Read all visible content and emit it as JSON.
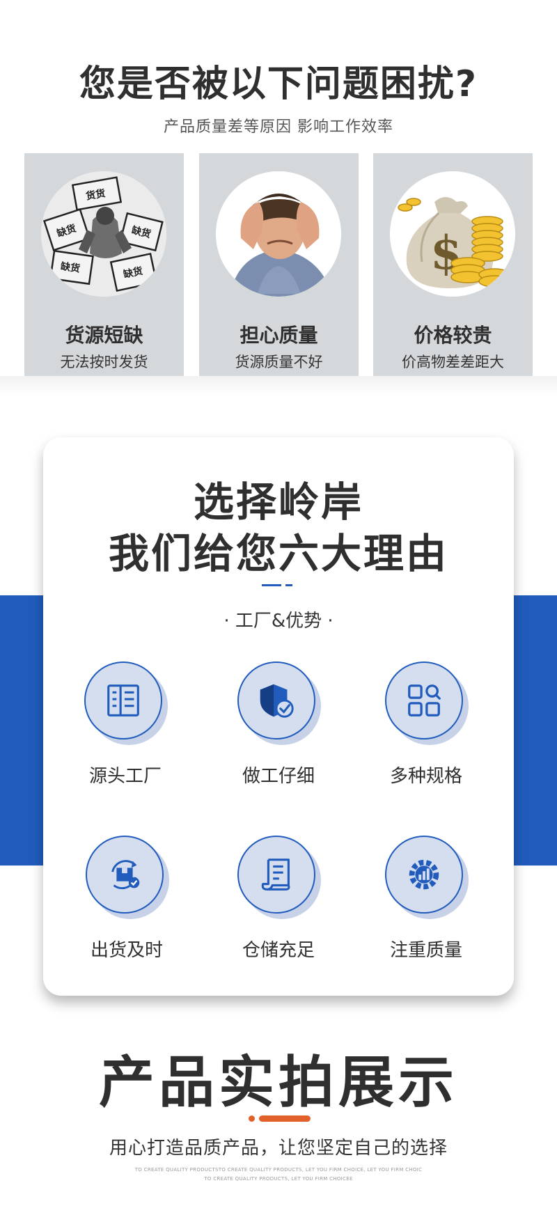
{
  "problems": {
    "title": "您是否被以下问题困扰?",
    "subtitle": "产品质量差等原因  影响工作效率",
    "cards": [
      {
        "title": "货源短缺",
        "desc": "无法按时发货",
        "image": "shipping-boxes-photo"
      },
      {
        "title": "担心质量",
        "desc": "货源质量不好",
        "image": "worried-man-photo"
      },
      {
        "title": "价格较贵",
        "desc": "价高物差差距大",
        "image": "money-bag-coins-photo"
      }
    ]
  },
  "reasons": {
    "title_line1": "选择岭岸",
    "title_line2": "我们给您六大理由",
    "tag": "· 工厂&优势 ·",
    "items": [
      {
        "label": "源头工厂",
        "icon": "factory-document-icon"
      },
      {
        "label": "做工仔细",
        "icon": "shield-check-icon"
      },
      {
        "label": "多种规格",
        "icon": "grid-search-icon"
      },
      {
        "label": "出货及时",
        "icon": "box-cycle-icon"
      },
      {
        "label": "仓储充足",
        "icon": "scroll-document-icon"
      },
      {
        "label": "注重质量",
        "icon": "gear-chart-icon"
      }
    ],
    "accent_color": "#215cbd"
  },
  "showcase": {
    "title": "产品实拍展示",
    "subtitle": "用心打造品质产品，让您坚定自己的选择",
    "english_line1": "TO CREATE QUALITY PRODUCTSTO CREATE QUALITY PRODUCTS, LET YOU FIRM CHOICE, LET YOU FIRM CHOIC",
    "english_line2": "TO CREATE QUALITY PRODUCTS, LET YOU FIRM CHOICEE",
    "accent_color": "#e2612a"
  }
}
